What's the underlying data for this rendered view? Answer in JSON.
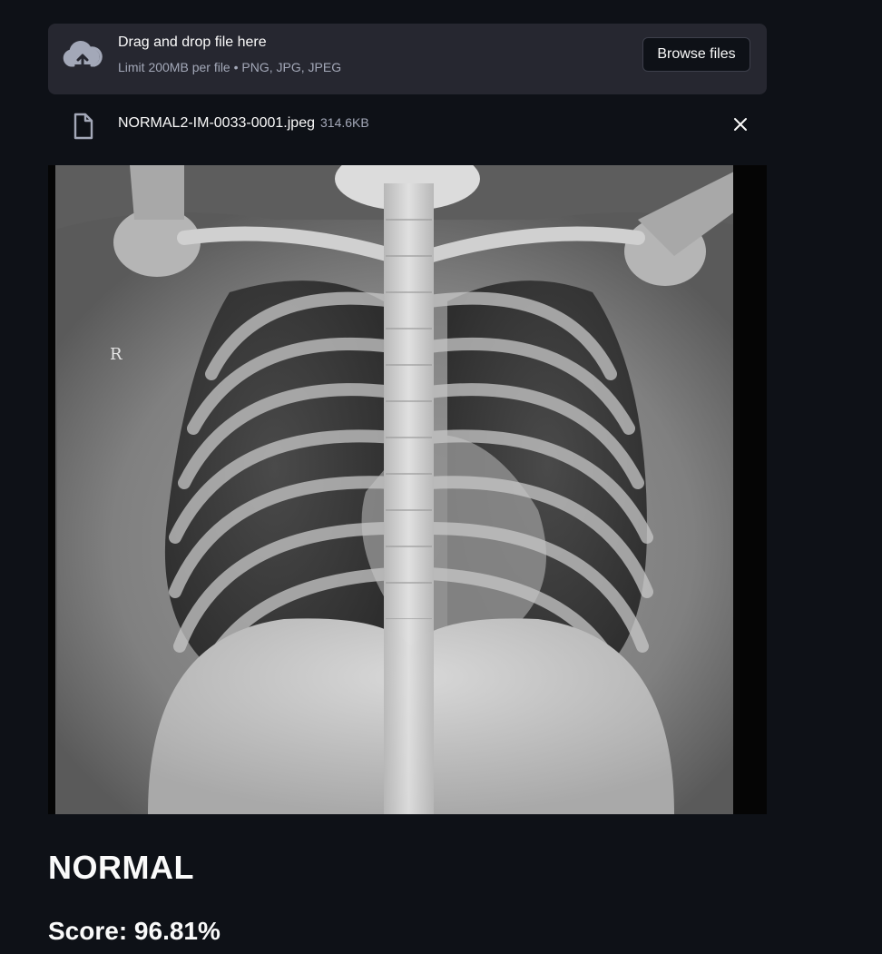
{
  "uploader": {
    "title": "Drag and drop file here",
    "limit": "Limit 200MB per file • PNG, JPG, JPEG",
    "browse_label": "Browse files",
    "icon": "cloud-upload-icon"
  },
  "file": {
    "name": "NORMAL2-IM-0033-0001.jpeg",
    "size": "314.6KB",
    "icon": "file-icon"
  },
  "image": {
    "marker": "R"
  },
  "result": {
    "label": "NORMAL",
    "score": "Score: 96.81%"
  }
}
